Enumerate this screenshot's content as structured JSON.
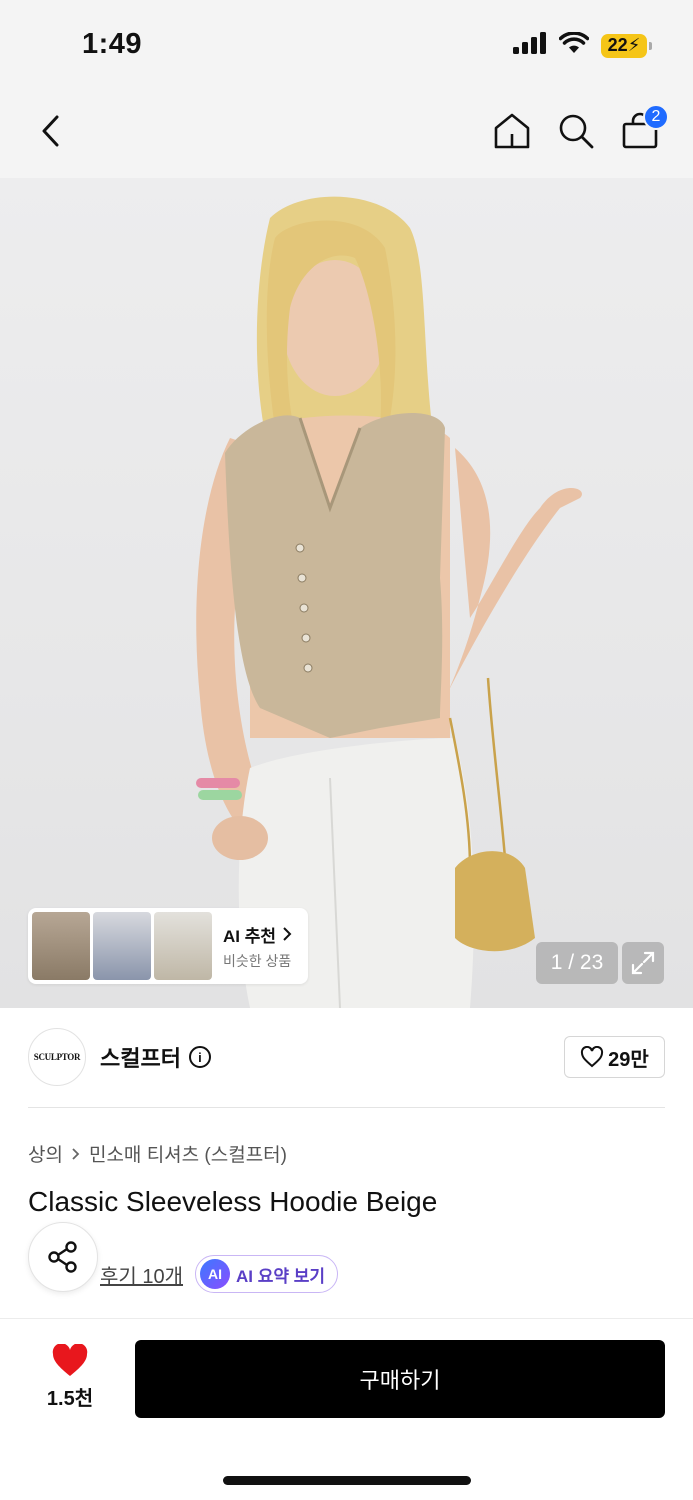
{
  "status_bar": {
    "time": "1:49",
    "battery": "22",
    "icons": [
      "signal-icon",
      "wifi-icon",
      "battery-icon"
    ]
  },
  "nav": {
    "icons": [
      "back-chevron-icon",
      "home-icon",
      "search-icon",
      "shopping-bag-icon"
    ],
    "cart_count": "2"
  },
  "gallery": {
    "counter": "1 / 23",
    "ai_recommend": {
      "title": "AI 추천",
      "subtitle": "비슷한 상품"
    }
  },
  "brand": {
    "logo_text": "SCULPTOR",
    "name": "스컬프터",
    "likes": "29만"
  },
  "breadcrumb": {
    "category": "상의",
    "subcategory": "민소매 티셔츠 (스컬프터)"
  },
  "product": {
    "title": "Classic Sleeveless Hoodie Beige",
    "reviews_label": "후기 10개",
    "ai_badge": "AI",
    "ai_summary_label": "AI 요약 보기"
  },
  "bottom_bar": {
    "like_count": "1.5천",
    "buy_label": "구매하기"
  },
  "colors": {
    "accent_blue": "#1f6bff",
    "heart_red": "#e8171d",
    "ai_purple": "#5a3fc6",
    "buy_button": "#000000"
  }
}
